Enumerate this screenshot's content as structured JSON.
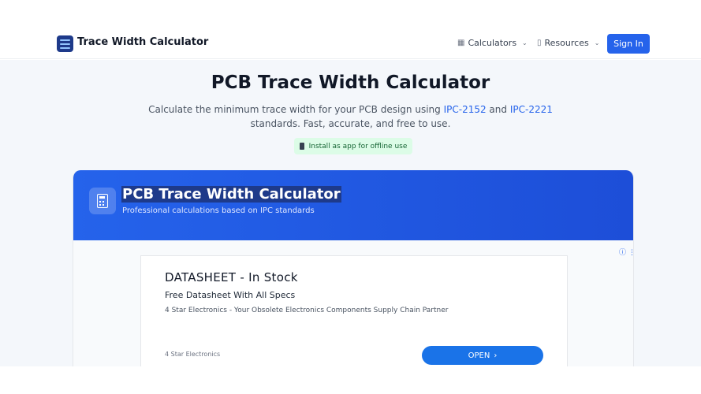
{
  "header": {
    "brand": "Trace Width Calculator",
    "nav": [
      {
        "label": "Calculators",
        "icon": "calculator-icon"
      },
      {
        "label": "Resources",
        "icon": "book-icon"
      }
    ],
    "signin_label": "Sign In"
  },
  "hero": {
    "title": "PCB Trace Width Calculator",
    "subtitle_before": "Calculate the minimum trace width for your PCB design using ",
    "link1": "IPC-2152",
    "subtitle_and": " and ",
    "link2": "IPC-2221",
    "subtitle_line2": "standards. Fast, accurate, and free to use.",
    "install_label": "Install as app for offline use"
  },
  "card": {
    "title": "PCB Trace Width Calculator",
    "subtitle": "Professional calculations based on IPC standards"
  },
  "ad": {
    "title": "DATASHEET - In Stock",
    "headline": "Free Datasheet With All Specs",
    "description": "4 Star Electronics - Your Obsolete Electronics Components Supply Chain Partner",
    "advertiser": "4 Star Electronics",
    "cta": "OPEN",
    "cta_glyph": "›",
    "info_glyphs": "ⓘ ⋮"
  },
  "colors": {
    "primary": "#2563eb",
    "card_header": "#1d4ed8",
    "install_bg": "#dcfce7",
    "ad_button": "#1a73e8"
  }
}
